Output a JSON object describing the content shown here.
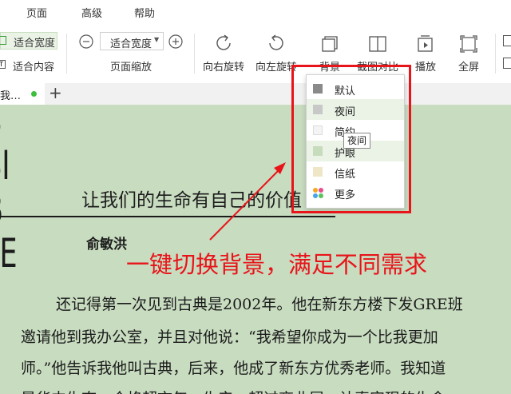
{
  "menu": {
    "items": [
      "页面",
      "高级",
      "帮助"
    ]
  },
  "toolbar": {
    "fit_width_label": "适合宽度",
    "fit_content_label": "适合内容",
    "zoom_select_value": "适合宽度",
    "zoom_group_label": "页面缩放",
    "rotate_right_label": "向右旋转",
    "rotate_left_label": "向左旋转",
    "background_label": "背景",
    "compare_label": "截图对比",
    "play_label": "播放",
    "fullscreen_label": "全屏"
  },
  "tabs": {
    "doc_tab_label": "我…",
    "add_tab": "+"
  },
  "dropdown": {
    "items": [
      {
        "label": "默认",
        "color": "#8a8a8a"
      },
      {
        "label": "夜间",
        "color": "#c8c8c8"
      },
      {
        "label": "简约",
        "color": "#f4f4f4"
      },
      {
        "label": "护眼",
        "color": "#c6dcbc"
      },
      {
        "label": "信纸",
        "color": "#efe6c8"
      },
      {
        "label": "更多",
        "color": "multi"
      }
    ],
    "tooltip": "夜间"
  },
  "annotation": {
    "callout_text": "一键切换背景，满足不同需求",
    "accent_color": "#e8141a"
  },
  "document": {
    "side_letters": "SSIBLE",
    "title": "让我们的生命有自己的价值",
    "author": "俞敏洪",
    "line1": "还记得第一次见到古典是2002年。他在新东方楼下发GRE班",
    "line2": "邀请他到我办公室，并且对他说：“我希望你成为一个比我更加",
    "line3": "师。”他告诉我他叫古典，后来，他成了新东方优秀老师。我知道",
    "line4": "是华中生态，合格超市年，生产，超过商业层，认真实现的生命"
  },
  "colors": {
    "doc_background": "#c8dcc0",
    "tab_dot": "#3cbf3c"
  }
}
